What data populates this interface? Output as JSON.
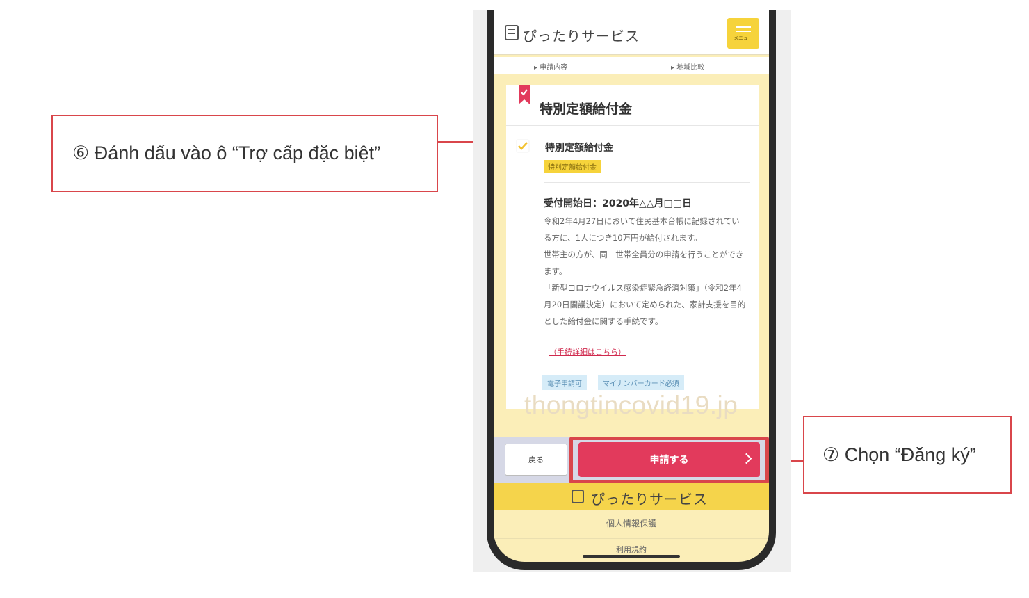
{
  "callouts": {
    "step6": "⑥ Đánh dấu vào ô “Trợ cấp đặc biệt”",
    "step7": "⑦ Chọn  “Đăng ký”"
  },
  "app": {
    "title": "ぴったりサービス",
    "menu_label": "メニュー",
    "subnav": {
      "left": "▸ 申請内容",
      "right": "▸ 地域比較"
    }
  },
  "card": {
    "title": "特別定額給付金",
    "item_title": "特別定額給付金",
    "item_tag": "特別定額給付金",
    "date_line": "受付開始日：2020年△△月□□日",
    "description": "令和2年4月27日において住民基本台帳に記録されている方に、1人につき10万円が給付されます。\n世帯主の方が、同一世帯全員分の申請を行うことができます。\n「新型コロナウイルス感染症緊急経済対策」（令和2年4月20日閣議決定）において定められた、家計支援を目的とした給付金に関する手続です。",
    "detail_link": "（手続詳細はこちら）",
    "badges": [
      "電子申請可",
      "マイナンバーカード必須"
    ]
  },
  "watermark": "thongtincovid19.jp",
  "footer": {
    "back_label": "戻る",
    "apply_label": "申請する",
    "brand": "ぴったりサービス",
    "privacy": "個人情報保護",
    "terms": "利用規約"
  },
  "colors": {
    "accent_red": "#e23a5c",
    "brand_yellow": "#f5d44b",
    "callout_border": "#d9464b"
  }
}
